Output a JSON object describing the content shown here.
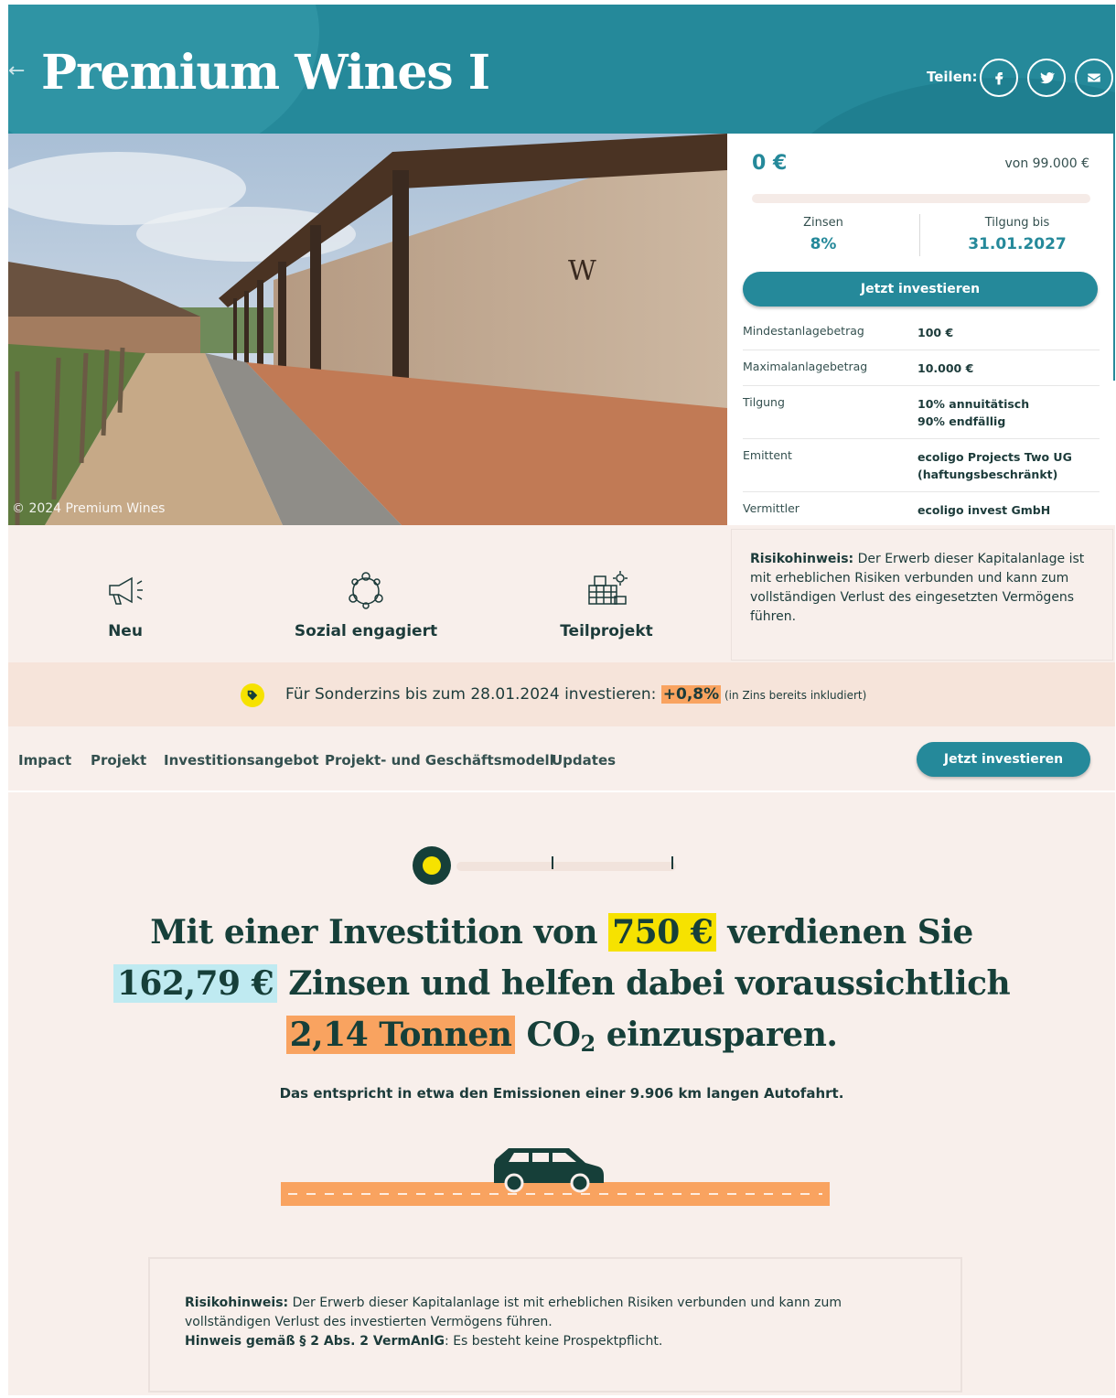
{
  "header": {
    "back_icon": "arrow-left-icon",
    "title": "Premium Wines I",
    "share_label": "Teilen:",
    "share_buttons": [
      "facebook-icon",
      "twitter-icon",
      "mail-icon"
    ]
  },
  "photo": {
    "copyright": "© 2024 Premium Wines"
  },
  "card": {
    "amount": "0 €",
    "amount_of": "von 99.000 €",
    "progress_fraction": 0,
    "interest_label": "Zinsen",
    "interest_value": "8%",
    "repayment_label": "Tilgung bis",
    "repayment_value": "31.01.2027",
    "invest_button": "Jetzt investieren",
    "terms": [
      {
        "key": "Mindestanlagebetrag",
        "value": "100 €"
      },
      {
        "key": "Maximalanlagebetrag",
        "value": "10.000 €"
      },
      {
        "key": "Tilgung",
        "value": "10% annuitätisch",
        "value2": "90% endfällig"
      },
      {
        "key": "Emittent",
        "value": "ecoligo Projects Two UG",
        "value2": "(haftungsbeschränkt)"
      },
      {
        "key": "Vermittler",
        "value": "ecoligo invest GmbH"
      }
    ]
  },
  "features": [
    {
      "label": "Neu",
      "icon": "megaphone-icon"
    },
    {
      "label": "Sozial engagiert",
      "icon": "community-icon"
    },
    {
      "label": "Teilprojekt",
      "icon": "solar-panel-icon"
    }
  ],
  "risk_top": {
    "bold": "Risikohinweis:",
    "text": " Der Erwerb dieser Kapitalanlage ist mit erheblichen Risiken verbunden und kann zum vollständigen Verlust des eingesetzten Vermögens führen."
  },
  "promo": {
    "icon": "tag-icon",
    "text": "Für Sonderzins bis zum 28.01.2024 investieren: ",
    "highlight": "+0,8%",
    "small": " (in Zins bereits inkludiert)"
  },
  "nav": {
    "items": [
      "Impact",
      "Projekt",
      "Investitionsangebot",
      "Projekt- und Geschäftsmodell",
      "Updates"
    ],
    "button": "Jetzt investieren"
  },
  "calculator": {
    "slider_position": 0,
    "line1_pre": "Mit einer Investition von ",
    "investment": "750 €",
    "line1_post": " verdienen Sie",
    "interest": "162,79 €",
    "line2_post": " Zinsen und helfen dabei voraussichtlich",
    "co2": "2,14 Tonnen",
    "co2_pre": " CO",
    "co2_sub": "2",
    "co2_post": " einzusparen.",
    "equivalent": "Das entspricht in etwa den Emissionen einer 9.906 km langen Autofahrt."
  },
  "risk_bottom": {
    "bold1": "Risikohinweis:",
    "text1": " Der Erwerb dieser Kapitalanlage ist mit erheblichen Risiken verbunden und kann zum vollständigen Verlust des investierten Vermögens führen.",
    "bold2": "Hinweis gemäß § 2 Abs. 2 VermAnlG",
    "text2": ": Es besteht keine Prospektpflicht."
  },
  "colors": {
    "brand": "#25899a",
    "dark": "#163f39",
    "yellow": "#f6e200",
    "orange": "#f9a360",
    "light_blue": "#bfeaf1",
    "background": "#f8efeb"
  }
}
